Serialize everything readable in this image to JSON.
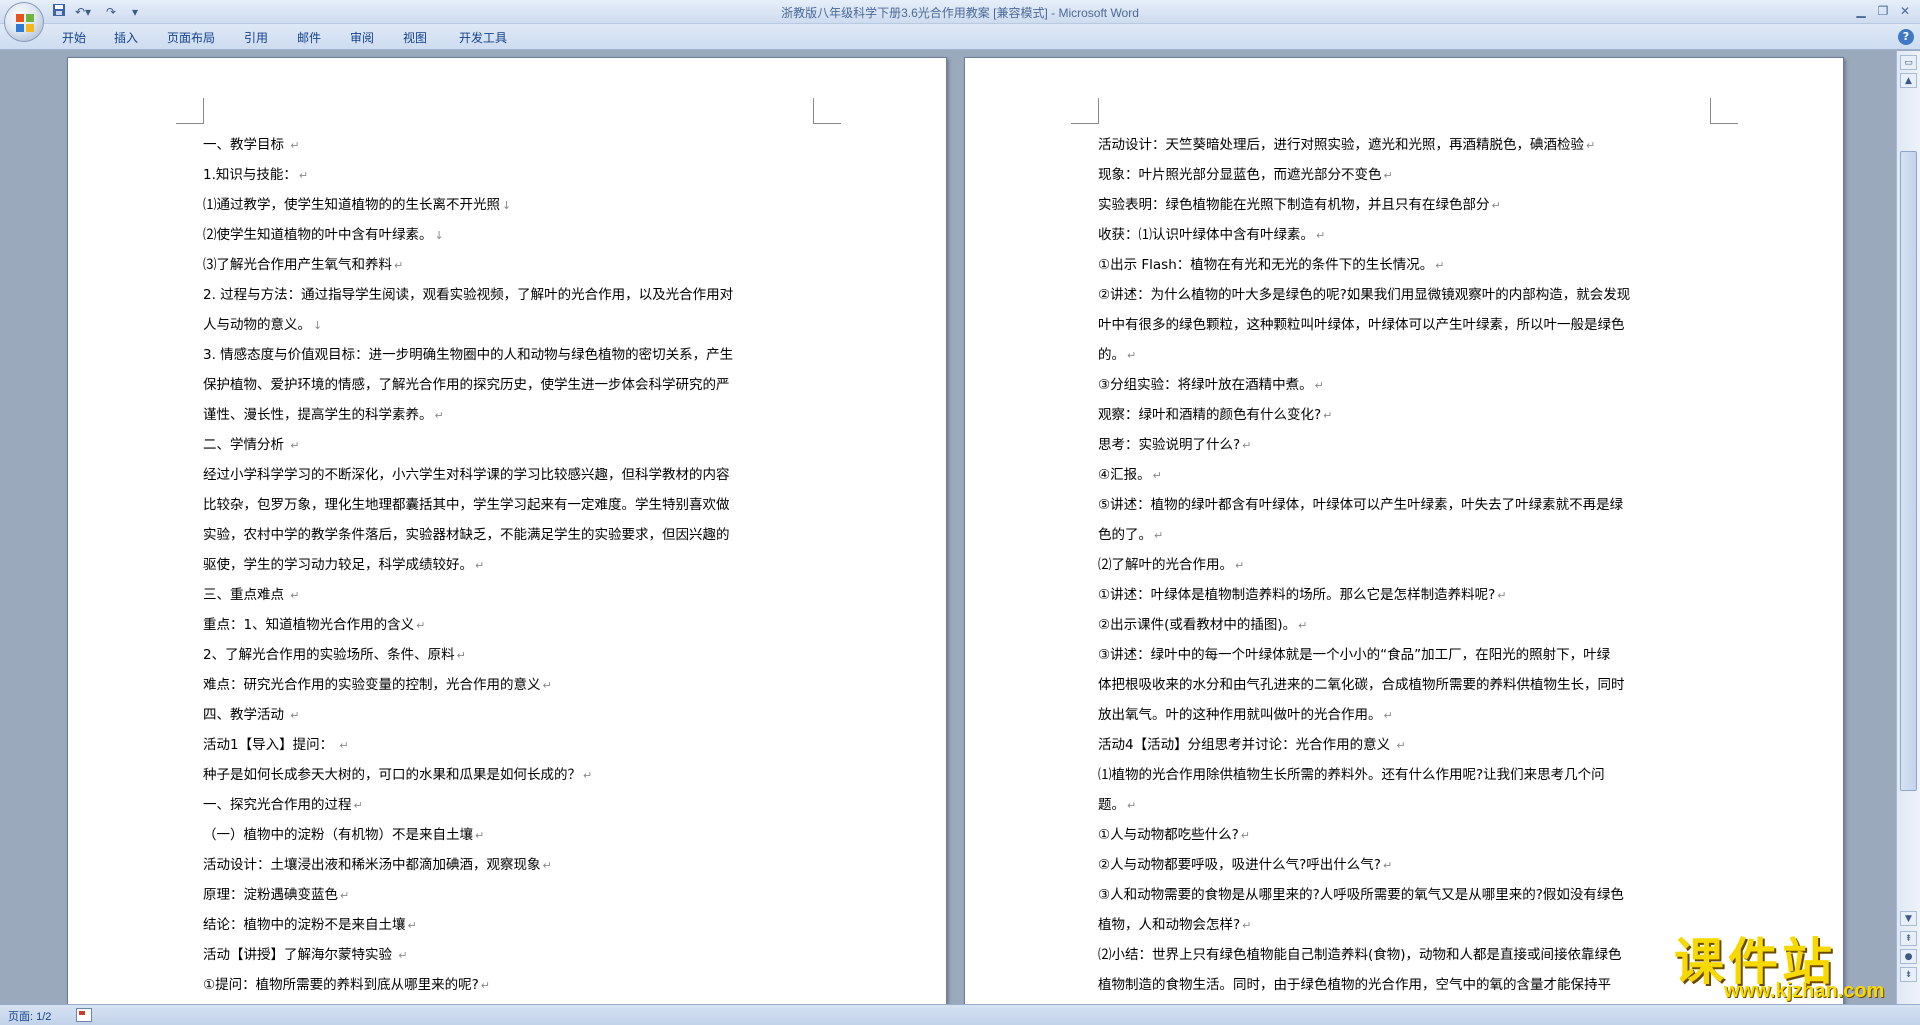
{
  "window": {
    "title": "浙教版八年级科学下册3.6光合作用教案 [兼容模式] - Microsoft Word",
    "controls": [
      "minimize",
      "restore",
      "close"
    ]
  },
  "quick_access": [
    "save-icon",
    "undo-icon",
    "redo-icon",
    "customize-icon"
  ],
  "ribbon_tabs": [
    "开始",
    "插入",
    "页面布局",
    "引用",
    "邮件",
    "审阅",
    "视图",
    "开发工具"
  ],
  "status": {
    "page": "页面: 1/2"
  },
  "watermark": {
    "main": "课件站",
    "url": "www.kjzhan.com"
  },
  "page1_lines": [
    {
      "t": "一、教学目标 ",
      "m": "↵"
    },
    {
      "t": "1.知识与技能：",
      "m": "↵"
    },
    {
      "t": "⑴通过教学，使学生知道植物的的生长离不开光照",
      "m": "↓"
    },
    {
      "t": "⑵使学生知道植物的叶中含有叶绿素。",
      "m": "↓"
    },
    {
      "t": "⑶了解光合作用产生氧气和养料",
      "m": "↵"
    },
    {
      "t": "2. 过程与方法：通过指导学生阅读，观看实验视频，了解叶的光合作用，以及光合作用对",
      "m": ""
    },
    {
      "t": "人与动物的意义。",
      "m": "↓"
    },
    {
      "t": "3. 情感态度与价值观目标：进一步明确生物圈中的人和动物与绿色植物的密切关系，产生",
      "m": ""
    },
    {
      "t": "保护植物、爱护环境的情感，了解光合作用的探究历史，使学生进一步体会科学研究的严",
      "m": ""
    },
    {
      "t": "谨性、漫长性，提高学生的科学素养。",
      "m": "↵"
    },
    {
      "t": "二、学情分析 ",
      "m": "↵"
    },
    {
      "t": "经过小学科学学习的不断深化，小六学生对科学课的学习比较感兴趣，但科学教材的内容",
      "m": ""
    },
    {
      "t": "比较杂，包罗万象，理化生地理都囊括其中，学生学习起来有一定难度。学生特别喜欢做",
      "m": ""
    },
    {
      "t": "实验，农村中学的教学条件落后，实验器材缺乏，不能满足学生的实验要求，但因兴趣的",
      "m": ""
    },
    {
      "t": "驱使，学生的学习动力较足，科学成绩较好。",
      "m": "↵"
    },
    {
      "t": "三、重点难点 ",
      "m": "↵"
    },
    {
      "t": "重点：1、知道植物光合作用的含义",
      "m": "↵"
    },
    {
      "t": "2、了解光合作用的实验场所、条件、原料",
      "m": "↵"
    },
    {
      "t": "难点：研究光合作用的实验变量的控制，光合作用的意义",
      "m": "↵"
    },
    {
      "t": "四、教学活动 ",
      "m": "↵"
    },
    {
      "t": "活动1【导入】提问： ",
      "m": "↵"
    },
    {
      "t": "种子是如何长成参天大树的，可口的水果和瓜果是如何长成的？",
      "m": "↵"
    },
    {
      "t": "一、探究光合作用的过程",
      "m": "↵"
    },
    {
      "t": "（一）植物中的淀粉（有机物）不是来自土壤",
      "m": "↵"
    },
    {
      "t": "活动设计：土壤浸出液和稀米汤中都滴加碘酒，观察现象",
      "m": "↵"
    },
    {
      "t": "原理：淀粉遇碘变蓝色",
      "m": "↵"
    },
    {
      "t": "结论：植物中的淀粉不是来自土壤",
      "m": "↵"
    },
    {
      "t": "活动【讲授】了解海尔蒙特实验 ",
      "m": "↵"
    },
    {
      "t": "①提问：植物所需要的养料到底从哪里来的呢?",
      "m": "↵"
    }
  ],
  "page2_lines": [
    {
      "t": "活动设计：天竺葵暗处理后，进行对照实验，遮光和光照，再酒精脱色，碘酒检验",
      "m": "↵"
    },
    {
      "t": "现象：叶片照光部分显蓝色，而遮光部分不变色",
      "m": "↵"
    },
    {
      "t": "实验表明：绿色植物能在光照下制造有机物，并且只有在绿色部分",
      "m": "↵"
    },
    {
      "t": "收获：⑴认识叶绿体中含有叶绿素。",
      "m": "↵"
    },
    {
      "t": "①出示 Flash：植物在有光和无光的条件下的生长情况。",
      "m": "↵"
    },
    {
      "t": "②讲述：为什么植物的叶大多是绿色的呢?如果我们用显微镜观察叶的内部构造，就会发现",
      "m": ""
    },
    {
      "t": "叶中有很多的绿色颗粒，这种颗粒叫叶绿体，叶绿体可以产生叶绿素，所以叶一般是绿色",
      "m": ""
    },
    {
      "t": "的。",
      "m": "↵"
    },
    {
      "t": "③分组实验：将绿叶放在酒精中煮。",
      "m": "↵"
    },
    {
      "t": "观察：绿叶和酒精的颜色有什么变化?",
      "m": "↵"
    },
    {
      "t": "思考：实验说明了什么?",
      "m": "↵"
    },
    {
      "t": "④汇报。",
      "m": "↵"
    },
    {
      "t": "⑤讲述：植物的绿叶都含有叶绿体，叶绿体可以产生叶绿素，叶失去了叶绿素就不再是绿",
      "m": ""
    },
    {
      "t": "色的了。",
      "m": "↵"
    },
    {
      "t": "⑵了解叶的光合作用。",
      "m": "↵"
    },
    {
      "t": "①讲述：叶绿体是植物制造养料的场所。那么它是怎样制造养料呢?",
      "m": "↵"
    },
    {
      "t": "②出示课件(或看教材中的插图)。",
      "m": "↵"
    },
    {
      "t": "③讲述：绿叶中的每一个叶绿体就是一个小小的“食品”加工厂，在阳光的照射下，叶绿",
      "m": ""
    },
    {
      "t": "体把根吸收来的水分和由气孔进来的二氧化碳，合成植物所需要的养料供植物生长，同时",
      "m": ""
    },
    {
      "t": "放出氧气。叶的这种作用就叫做叶的光合作用。",
      "m": "↵"
    },
    {
      "t": "活动4【活动】分组思考并讨论：光合作用的意义 ",
      "m": "↵"
    },
    {
      "t": "⑴植物的光合作用除供植物生长所需的养料外。还有什么作用呢?让我们来思考几个问",
      "m": ""
    },
    {
      "t": "题。",
      "m": "↵"
    },
    {
      "t": "①人与动物都吃些什么?",
      "m": "↵"
    },
    {
      "t": "②人与动物都要呼吸，吸进什么气?呼出什么气?",
      "m": "↵"
    },
    {
      "t": "③人和动物需要的食物是从哪里来的?人呼吸所需要的氧气又是从哪里来的?假如没有绿色",
      "m": ""
    },
    {
      "t": "植物，人和动物会怎样?",
      "m": "↵"
    },
    {
      "t": "⑵小结：世界上只有绿色植物能自己制造养料(食物)，动物和人都是直接或间接依靠绿色",
      "m": ""
    },
    {
      "t": "植物制造的食物生活。同时，由于绿色植物的光合作用，空气中的氧的含量才能保持平",
      "m": ""
    }
  ]
}
